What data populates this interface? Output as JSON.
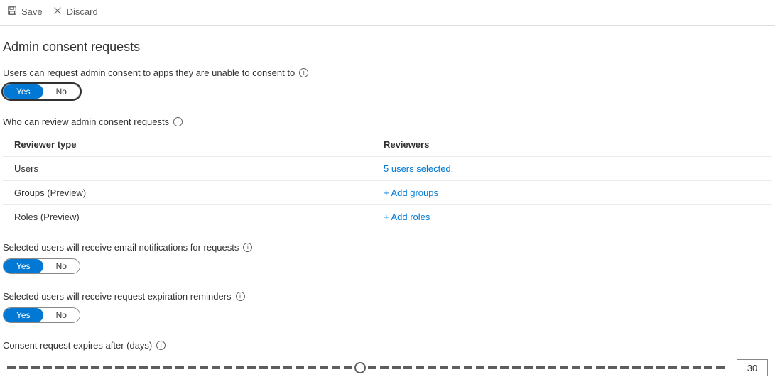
{
  "toolbar": {
    "save_label": "Save",
    "discard_label": "Discard"
  },
  "section": {
    "title": "Admin consent requests"
  },
  "fields": {
    "users_can_request": {
      "label": "Users can request admin consent to apps they are unable to consent to",
      "yes": "Yes",
      "no": "No",
      "value": true
    },
    "who_can_review": {
      "label": "Who can review admin consent requests"
    },
    "email_notifications": {
      "label": "Selected users will receive email notifications for requests",
      "yes": "Yes",
      "no": "No",
      "value": true
    },
    "expiration_reminders": {
      "label": "Selected users will receive request expiration reminders",
      "yes": "Yes",
      "no": "No",
      "value": true
    },
    "expires_after": {
      "label": "Consent request expires after (days)",
      "value": "30",
      "min": 1,
      "max": 60
    }
  },
  "table": {
    "headers": {
      "type": "Reviewer type",
      "reviewers": "Reviewers"
    },
    "rows": [
      {
        "type": "Users",
        "reviewers": "5 users selected."
      },
      {
        "type": "Groups (Preview)",
        "reviewers": "+ Add groups"
      },
      {
        "type": "Roles (Preview)",
        "reviewers": "+ Add roles"
      }
    ]
  }
}
